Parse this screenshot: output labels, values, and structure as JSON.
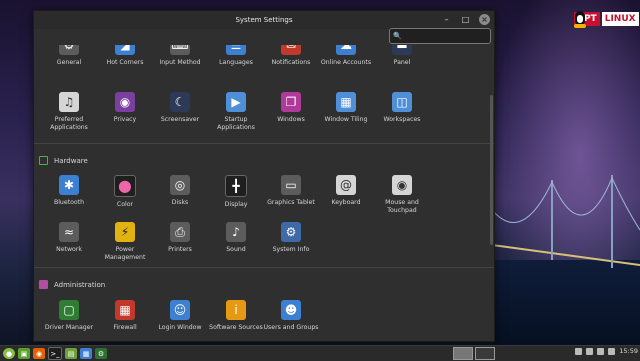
{
  "window": {
    "title": "System Settings"
  },
  "search": {
    "value": "",
    "placeholder": ""
  },
  "sections": {
    "preferences_row1": [
      {
        "label": "General",
        "icon": "general-icon"
      },
      {
        "label": "Hot Corners",
        "icon": "hot-corners-icon"
      },
      {
        "label": "Input Method",
        "icon": "input-method-icon"
      },
      {
        "label": "Languages",
        "icon": "languages-icon"
      },
      {
        "label": "Notifications",
        "icon": "notifications-icon"
      },
      {
        "label": "Online Accounts",
        "icon": "online-accounts-icon"
      },
      {
        "label": "Panel",
        "icon": "panel-icon"
      }
    ],
    "preferences_row2": [
      {
        "label": "Preferred Applications",
        "icon": "preferred-applications-icon"
      },
      {
        "label": "Privacy",
        "icon": "privacy-icon"
      },
      {
        "label": "Screensaver",
        "icon": "screensaver-icon"
      },
      {
        "label": "Startup Applications",
        "icon": "startup-applications-icon"
      },
      {
        "label": "Windows",
        "icon": "windows-icon"
      },
      {
        "label": "Window Tiling",
        "icon": "window-tiling-icon"
      },
      {
        "label": "Workspaces",
        "icon": "workspaces-icon"
      }
    ],
    "hardware": {
      "title": "Hardware",
      "row1": [
        {
          "label": "Bluetooth",
          "icon": "bluetooth-icon"
        },
        {
          "label": "Color",
          "icon": "color-icon"
        },
        {
          "label": "Disks",
          "icon": "disks-icon"
        },
        {
          "label": "Display",
          "icon": "display-icon"
        },
        {
          "label": "Graphics Tablet",
          "icon": "graphics-tablet-icon"
        },
        {
          "label": "Keyboard",
          "icon": "keyboard-icon"
        },
        {
          "label": "Mouse and Touchpad",
          "icon": "mouse-icon"
        }
      ],
      "row2": [
        {
          "label": "Network",
          "icon": "network-icon"
        },
        {
          "label": "Power Management",
          "icon": "power-icon"
        },
        {
          "label": "Printers",
          "icon": "printers-icon"
        },
        {
          "label": "Sound",
          "icon": "sound-icon"
        },
        {
          "label": "System Info",
          "icon": "system-info-icon"
        }
      ]
    },
    "administration": {
      "title": "Administration",
      "row1": [
        {
          "label": "Driver Manager",
          "icon": "driver-manager-icon"
        },
        {
          "label": "Firewall",
          "icon": "firewall-icon"
        },
        {
          "label": "Login Window",
          "icon": "login-window-icon"
        },
        {
          "label": "Software Sources",
          "icon": "software-sources-icon"
        },
        {
          "label": "Users and Groups",
          "icon": "users-groups-icon"
        }
      ]
    }
  },
  "logo": {
    "part1": "APT",
    "part2": "LINUX"
  },
  "taskbar": {
    "clock": "15:59"
  }
}
